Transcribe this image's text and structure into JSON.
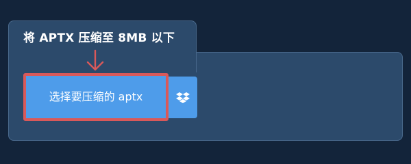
{
  "panel": {
    "title": "将 APTX 压缩至 8MB 以下"
  },
  "upload": {
    "choose_button_label": "选择要压缩的 aptx",
    "dropbox_icon": "dropbox-icon",
    "arrow_icon": "arrow-down-icon"
  },
  "colors": {
    "page_background": "#13243a",
    "panel_background": "#2c4a6b",
    "button_background": "#4e9cea",
    "highlight": "#d9595a"
  }
}
